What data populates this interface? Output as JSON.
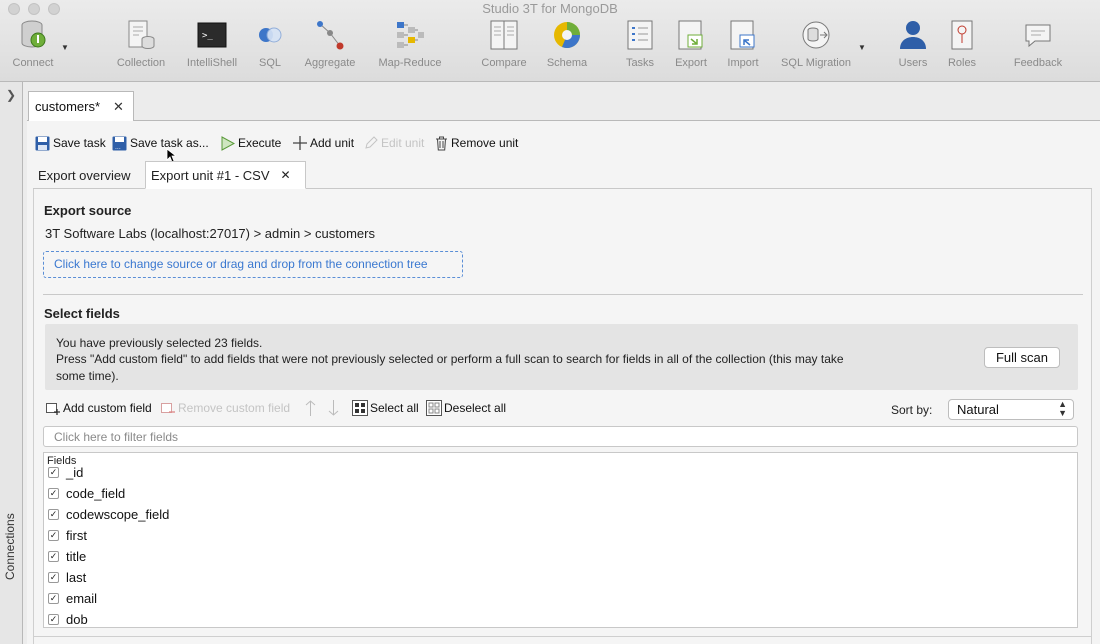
{
  "window": {
    "title": "Studio 3T for MongoDB"
  },
  "toolbar": {
    "items": [
      {
        "label": "Connect",
        "icon": "connect-icon"
      },
      {
        "label": "Collection",
        "icon": "collection-icon"
      },
      {
        "label": "IntelliShell",
        "icon": "terminal-icon"
      },
      {
        "label": "SQL",
        "icon": "sql-icon"
      },
      {
        "label": "Aggregate",
        "icon": "aggregate-icon"
      },
      {
        "label": "Map-Reduce",
        "icon": "map-reduce-icon"
      },
      {
        "label": "Compare",
        "icon": "compare-icon"
      },
      {
        "label": "Schema",
        "icon": "schema-icon"
      },
      {
        "label": "Tasks",
        "icon": "tasks-icon"
      },
      {
        "label": "Export",
        "icon": "export-icon"
      },
      {
        "label": "Import",
        "icon": "import-icon"
      },
      {
        "label": "SQL Migration",
        "icon": "sql-migration-icon"
      },
      {
        "label": "Users",
        "icon": "users-icon"
      },
      {
        "label": "Roles",
        "icon": "roles-icon"
      },
      {
        "label": "Feedback",
        "icon": "feedback-icon"
      }
    ]
  },
  "sidebar": {
    "label": "Connections",
    "toggle_icon": "chevron-right-icon"
  },
  "document_tab": {
    "label": "customers*",
    "close": "✕"
  },
  "actions": {
    "save_task": "Save task",
    "save_task_as": "Save task as...",
    "execute": "Execute",
    "add_unit": "Add unit",
    "edit_unit": "Edit unit",
    "remove_unit": "Remove unit"
  },
  "tabs": {
    "overview": "Export overview",
    "unit": "Export unit #1 - CSV",
    "close": "✕"
  },
  "export_source": {
    "heading": "Export source",
    "path": "3T Software Labs (localhost:27017) > admin > customers",
    "change_hint": "Click here to change source or drag and drop from the connection tree"
  },
  "select_fields": {
    "heading": "Select fields",
    "info_line1": "You have previously selected 23 fields.",
    "info_line2": "Press \"Add custom field\" to add fields that were not previously selected or perform a full scan to search for fields in all of the collection (this may take",
    "info_line3": "some time).",
    "full_scan": "Full scan",
    "add_custom": "Add custom field",
    "remove_custom": "Remove custom field",
    "select_all": "Select all",
    "deselect_all": "Deselect all",
    "sort_label": "Sort by:",
    "sort_value": "Natural",
    "filter_placeholder": "Click here to filter fields",
    "fields_header": "Fields",
    "fields": [
      {
        "name": "_id",
        "checked": true
      },
      {
        "name": "code_field",
        "checked": true
      },
      {
        "name": "codewscope_field",
        "checked": true
      },
      {
        "name": "first",
        "checked": true
      },
      {
        "name": "title",
        "checked": true
      },
      {
        "name": "last",
        "checked": true
      },
      {
        "name": "email",
        "checked": true
      },
      {
        "name": "dob",
        "checked": true
      }
    ]
  }
}
